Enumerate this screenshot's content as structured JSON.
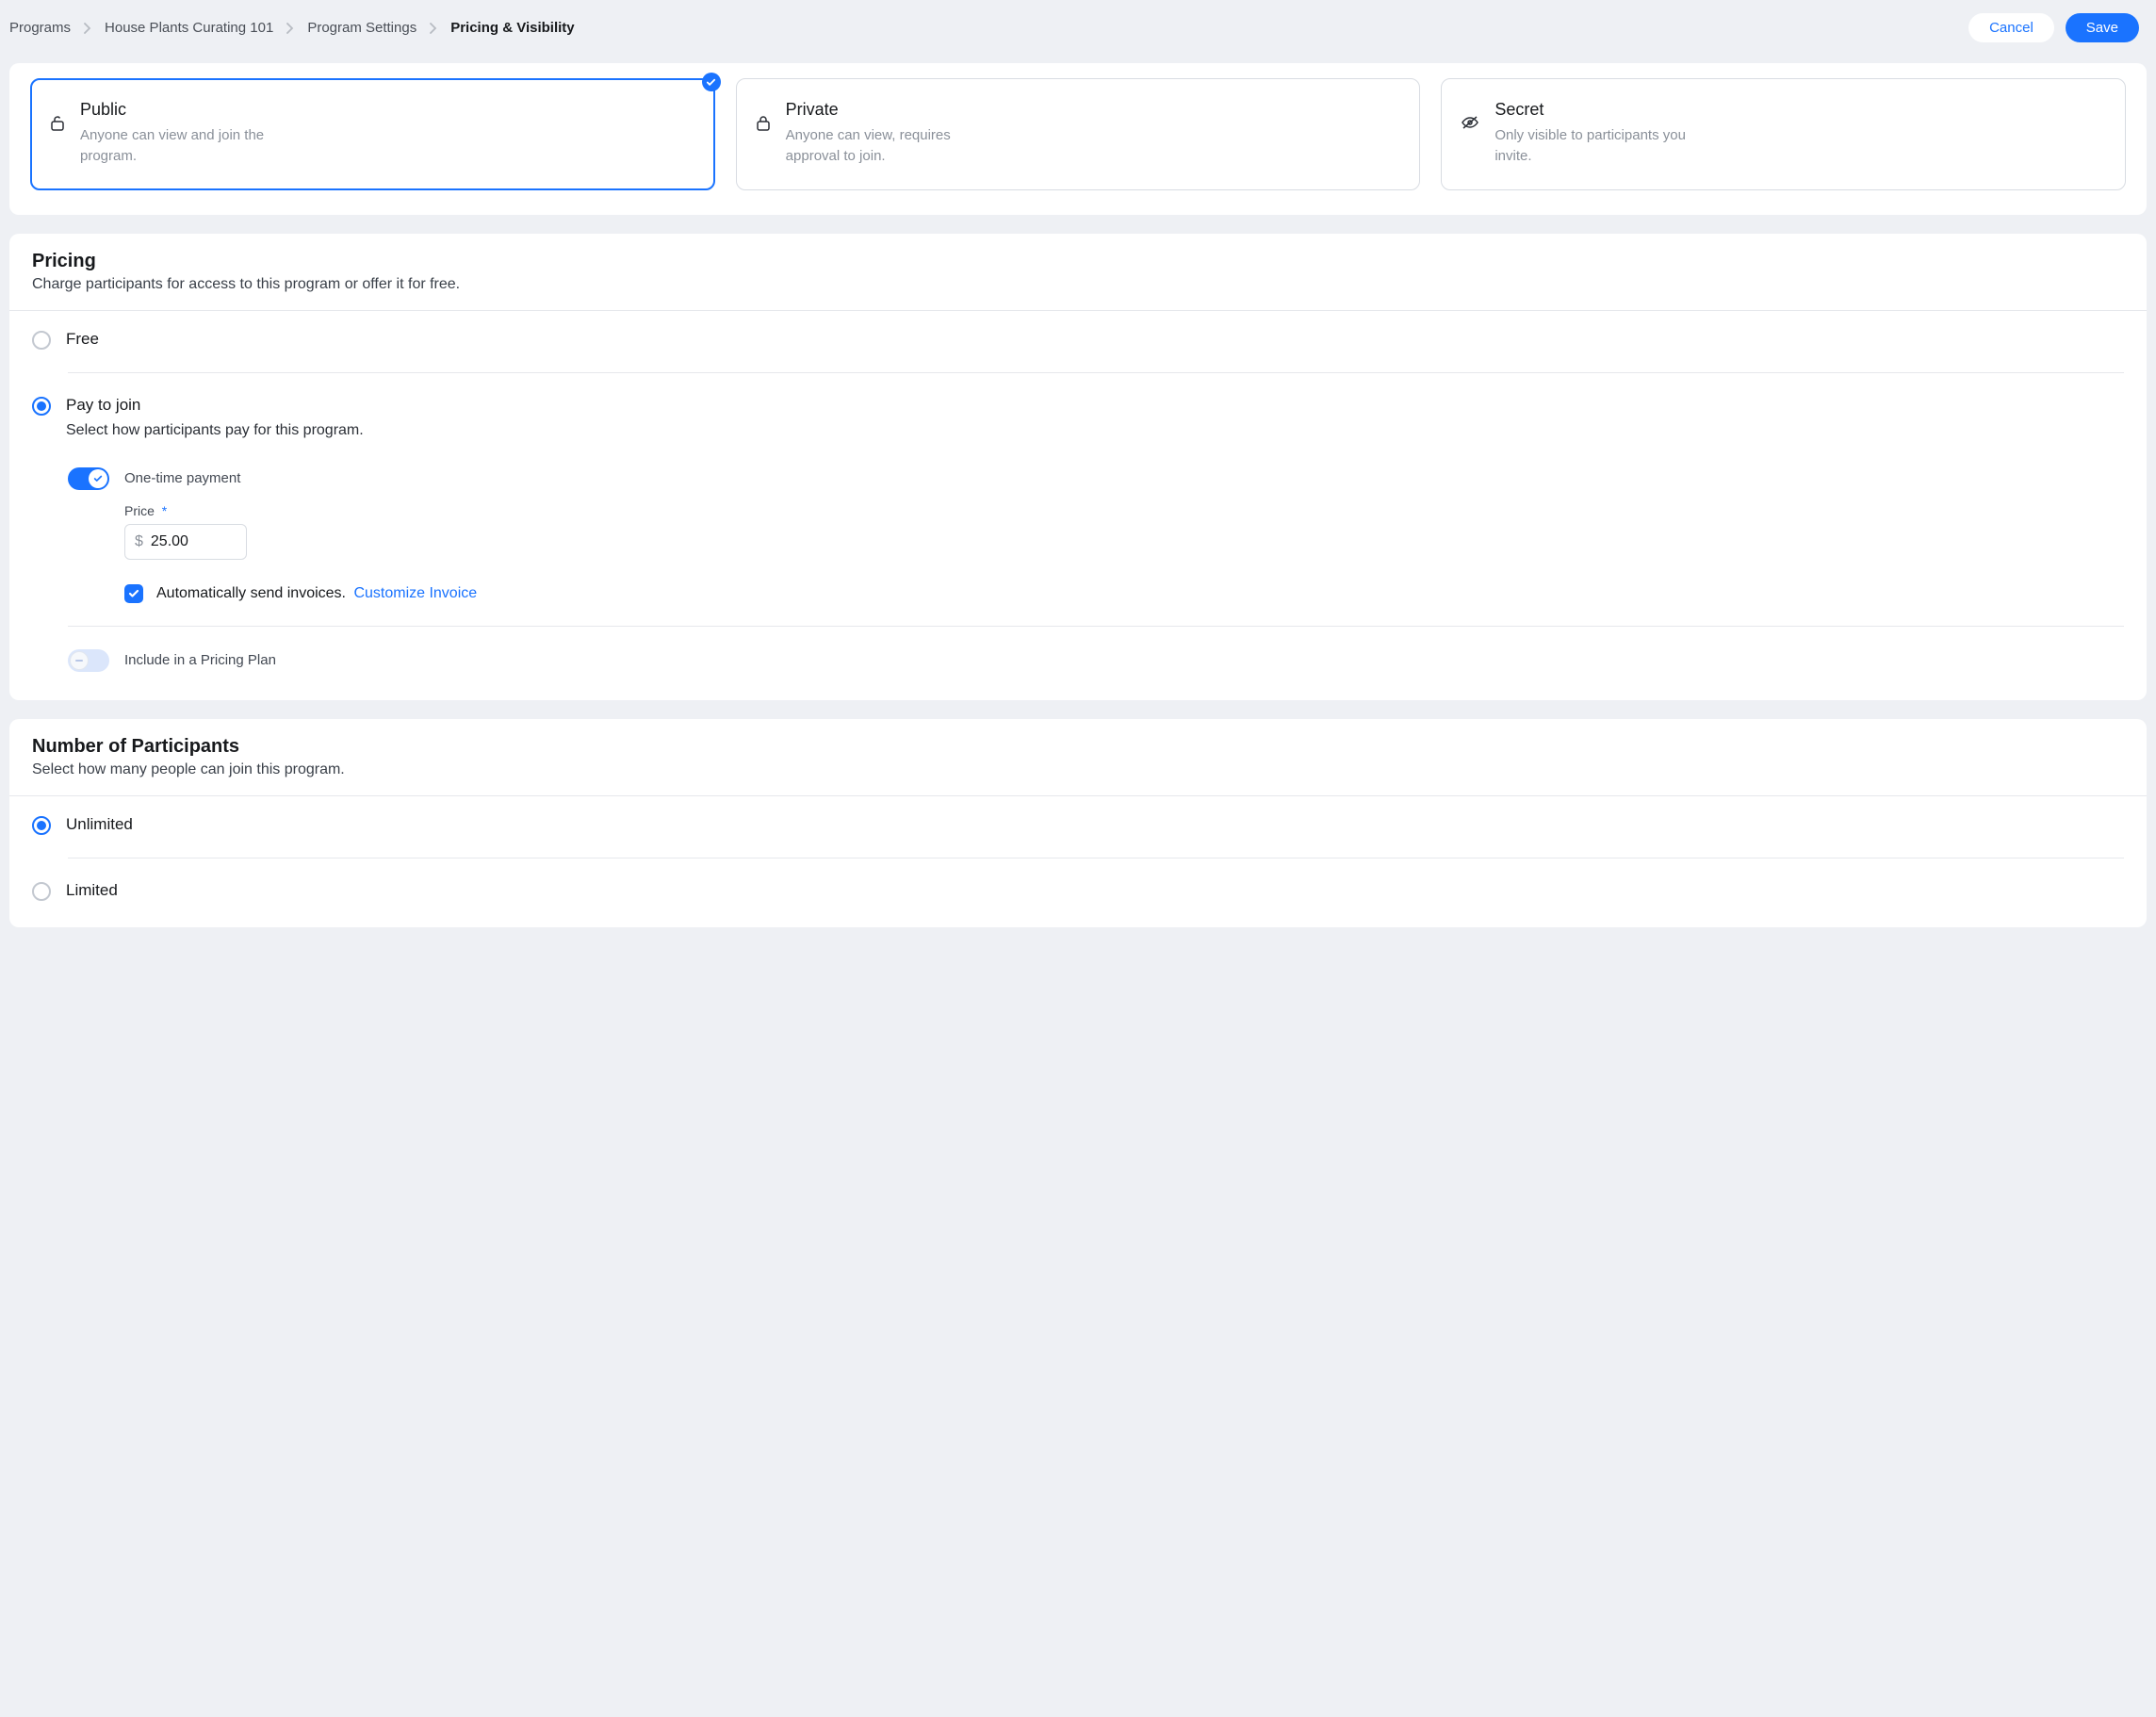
{
  "header": {
    "breadcrumb": [
      {
        "label": "Programs",
        "current": false
      },
      {
        "label": "House Plants Curating 101",
        "current": false
      },
      {
        "label": "Program Settings",
        "current": false
      },
      {
        "label": "Pricing & Visibility",
        "current": true
      }
    ],
    "cancel": "Cancel",
    "save": "Save"
  },
  "visibility": {
    "options": [
      {
        "key": "public",
        "title": "Public",
        "sub": "Anyone can view and join the program.",
        "icon": "lock-open-icon",
        "selected": true
      },
      {
        "key": "private",
        "title": "Private",
        "sub": "Anyone can view, requires approval to join.",
        "icon": "lock-icon",
        "selected": false
      },
      {
        "key": "secret",
        "title": "Secret",
        "sub": "Only visible to participants you invite.",
        "icon": "eye-off-icon",
        "selected": false
      }
    ]
  },
  "pricing": {
    "title": "Pricing",
    "sub": "Charge participants for access to this program or offer it for free.",
    "free_label": "Free",
    "pay_label": "Pay to join",
    "pay_sub": "Select how participants pay for this program.",
    "one_time": {
      "enabled": true,
      "label": "One-time payment",
      "price_label": "Price",
      "required_mark": "*",
      "currency": "$",
      "value": "25.00"
    },
    "auto_invoice": {
      "checked": true,
      "label": "Automatically send invoices.",
      "link": "Customize Invoice"
    },
    "pricing_plan": {
      "enabled": false,
      "label": "Include in a Pricing Plan"
    },
    "selected": "pay"
  },
  "participants": {
    "title": "Number of Participants",
    "sub": "Select how many people can join this program.",
    "unlimited_label": "Unlimited",
    "limited_label": "Limited",
    "selected": "unlimited"
  }
}
